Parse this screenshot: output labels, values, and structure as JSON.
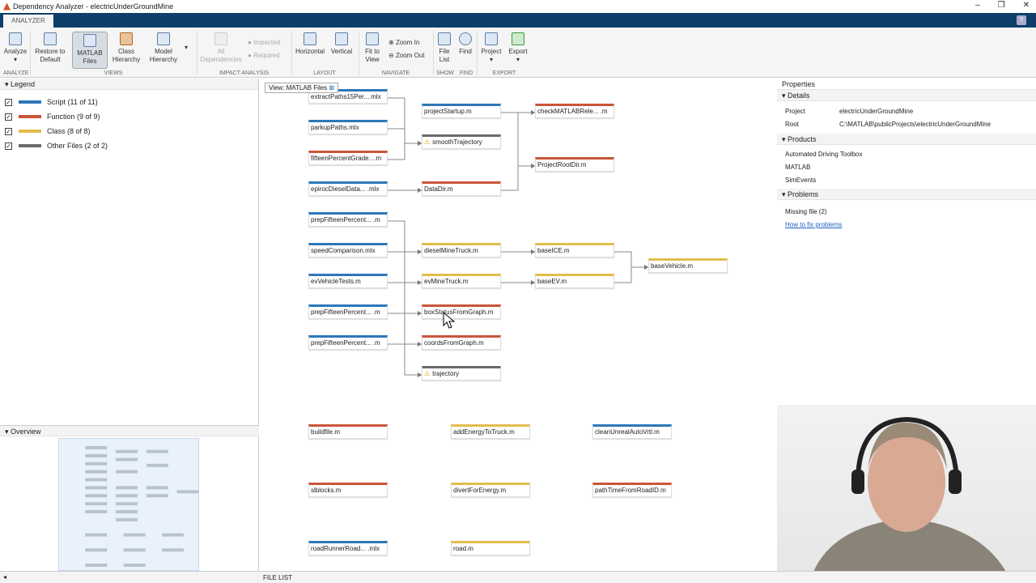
{
  "window": {
    "title": "Dependency Analyzer - electricUnderGroundMine",
    "minimize": "–",
    "maximize": "❐",
    "close": "✕"
  },
  "tab": "ANALYZER",
  "help": "?",
  "toolbar": {
    "analyze": "Analyze",
    "restore": "Restore to Default",
    "matlab_files": "MATLAB Files",
    "class_hierarchy": "Class Hierarchy",
    "model_hierarchy": "Model Hierarchy",
    "all_dependencies": "All Dependencies",
    "impacted": "Impacted",
    "required": "Required",
    "horizontal": "Horizontal",
    "vertical": "Vertical",
    "fit_to_view": "Fit to View",
    "zoom_in": "Zoom In",
    "zoom_out": "Zoom Out",
    "file_list": "File List",
    "find": "Find",
    "project": "Project",
    "export": "Export",
    "sections": [
      "ANALYZE",
      "VIEWS",
      "IMPACT ANALYSIS",
      "LAYOUT",
      "NAVIGATE",
      "SHOW",
      "FIND",
      "EXPORT"
    ]
  },
  "legend": {
    "title": "Legend",
    "items": [
      {
        "label": "Script (11 of 11)",
        "color": "#2c78b8"
      },
      {
        "label": "Function (9 of 9)",
        "color": "#c9553a"
      },
      {
        "label": "Class (8 of 8)",
        "color": "#e3bd4b"
      },
      {
        "label": "Other Files (2 of 2)",
        "color": "#6b6b6b"
      }
    ]
  },
  "overview": {
    "title": "Overview"
  },
  "graph": {
    "view_tag": "View: MATLAB Files",
    "nodes": [
      {
        "id": "n1",
        "label": "extractPaths15Per....mlx",
        "type": "script"
      },
      {
        "id": "n2",
        "label": "parkupPaths.mlx",
        "type": "script"
      },
      {
        "id": "n3",
        "label": "fifteenPercentGrade....m",
        "type": "function"
      },
      {
        "id": "n4",
        "label": "epirocDieselData... .mlx",
        "type": "script"
      },
      {
        "id": "n5",
        "label": "prepFifteenPercent... .m",
        "type": "script"
      },
      {
        "id": "n6",
        "label": "speedComparison.mlx",
        "type": "script"
      },
      {
        "id": "n7",
        "label": "evVehicleTests.m",
        "type": "script"
      },
      {
        "id": "n8",
        "label": "prepFifteenPercent... .m",
        "type": "script"
      },
      {
        "id": "n9",
        "label": "prepFifteenPercent... .m",
        "type": "script"
      },
      {
        "id": "m1",
        "label": "projectStartup.m",
        "type": "script"
      },
      {
        "id": "m2",
        "label": "smoothTrajectory",
        "type": "other",
        "warning": true
      },
      {
        "id": "m3",
        "label": "DataDir.m",
        "type": "function"
      },
      {
        "id": "m4",
        "label": "dieselMineTruck.m",
        "type": "class"
      },
      {
        "id": "m5",
        "label": "evMineTruck.m",
        "type": "class"
      },
      {
        "id": "m6",
        "label": "boxStatusFromGraph.m",
        "type": "function"
      },
      {
        "id": "m7",
        "label": "coordsFromGraph.m",
        "type": "function"
      },
      {
        "id": "m8",
        "label": "trajectory",
        "type": "other",
        "warning": true
      },
      {
        "id": "c1",
        "label": "checkMATLABRele... .m",
        "type": "function"
      },
      {
        "id": "c2",
        "label": "ProjectRootDir.m",
        "type": "function"
      },
      {
        "id": "c3",
        "label": "baseICE.m",
        "type": "class"
      },
      {
        "id": "c4",
        "label": "baseEV.m",
        "type": "class"
      },
      {
        "id": "d1",
        "label": "baseVehicle.m",
        "type": "class"
      },
      {
        "id": "b1",
        "label": "buildfile.m",
        "type": "function"
      },
      {
        "id": "b2",
        "label": "addEnergyToTruck.m",
        "type": "class"
      },
      {
        "id": "b3",
        "label": "cleanUnrealAutoVrtl.m",
        "type": "script"
      },
      {
        "id": "b4",
        "label": "slblocks.m",
        "type": "function"
      },
      {
        "id": "b5",
        "label": "divertForEnergy.m",
        "type": "class"
      },
      {
        "id": "b6",
        "label": "pathTimeFromRoadID.m",
        "type": "function"
      },
      {
        "id": "b7",
        "label": "roadRunnerRoad... .mlx",
        "type": "script"
      },
      {
        "id": "b8",
        "label": "road.m",
        "type": "class"
      }
    ],
    "edges": [
      [
        "n1",
        "m2"
      ],
      [
        "n2",
        "m2"
      ],
      [
        "n3",
        "m2"
      ],
      [
        "n4",
        "m3"
      ],
      [
        "n5",
        "m8"
      ],
      [
        "n6",
        "m4"
      ],
      [
        "n7",
        "m5"
      ],
      [
        "n8",
        "m6"
      ],
      [
        "n9",
        "m7"
      ],
      [
        "m1",
        "c1"
      ],
      [
        "m1",
        "c2"
      ],
      [
        "m3",
        "c2"
      ],
      [
        "m4",
        "c3"
      ],
      [
        "m5",
        "c4"
      ],
      [
        "c3",
        "d1"
      ],
      [
        "c4",
        "d1"
      ]
    ]
  },
  "properties": {
    "title": "Properties",
    "details": {
      "title": "Details",
      "project_key": "Project",
      "project": "electricUnderGroundMine",
      "root_key": "Root",
      "root": "C:\\MATLAB\\publicProjects\\electricUnderGroundMine"
    },
    "products": {
      "title": "Products",
      "items": [
        "Automated Driving Toolbox",
        "MATLAB",
        "SimEvents"
      ]
    },
    "problems": {
      "title": "Problems",
      "missing": "Missing file (2)",
      "link": "How to fix problems"
    }
  },
  "bottom": {
    "file_list": "FILE LIST"
  }
}
